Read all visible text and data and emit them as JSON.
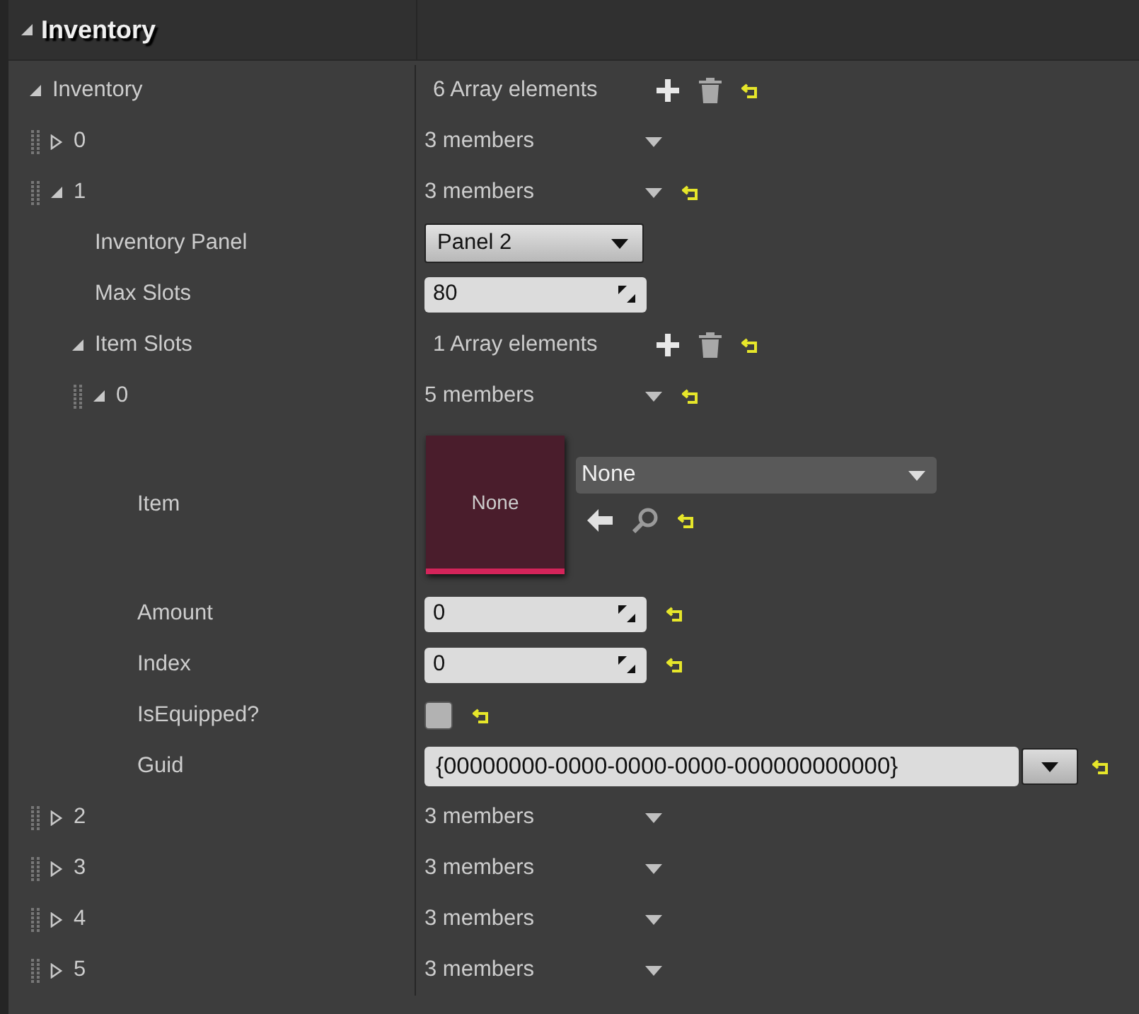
{
  "category": {
    "title": "Inventory",
    "expanded": true
  },
  "tree": [
    {
      "label": "Inventory",
      "kind": "array",
      "value": "6 Array elements",
      "expanded": true,
      "reset": true,
      "children": [
        {
          "label": "0",
          "kind": "element",
          "value": "3 members",
          "expanded": false,
          "reset": false
        },
        {
          "label": "1",
          "kind": "element",
          "value": "3 members",
          "expanded": true,
          "reset": true,
          "children": [
            {
              "label": "Inventory Panel",
              "kind": "combo",
              "value": "Panel 2",
              "reset": false
            },
            {
              "label": "Max Slots",
              "kind": "number",
              "value": "80",
              "reset": false
            },
            {
              "label": "Item Slots",
              "kind": "array",
              "value": "1 Array elements",
              "expanded": true,
              "reset": true,
              "children": [
                {
                  "label": "0",
                  "kind": "element",
                  "value": "5 members",
                  "expanded": true,
                  "reset": true,
                  "children": [
                    {
                      "label": "Item",
                      "kind": "asset",
                      "thumbnail": "None",
                      "value": "None",
                      "reset": true
                    },
                    {
                      "label": "Amount",
                      "kind": "number",
                      "value": "0",
                      "reset": true
                    },
                    {
                      "label": "Index",
                      "kind": "number",
                      "value": "0",
                      "reset": true
                    },
                    {
                      "label": "IsEquipped?",
                      "kind": "checkbox",
                      "checked": false,
                      "reset": true
                    },
                    {
                      "label": "Guid",
                      "kind": "guid",
                      "value": "{00000000-0000-0000-0000-000000000000}",
                      "reset": true
                    }
                  ]
                }
              ]
            }
          ]
        },
        {
          "label": "2",
          "kind": "element",
          "value": "3 members",
          "expanded": false,
          "reset": false
        },
        {
          "label": "3",
          "kind": "element",
          "value": "3 members",
          "expanded": false,
          "reset": false
        },
        {
          "label": "4",
          "kind": "element",
          "value": "3 members",
          "expanded": false,
          "reset": false
        },
        {
          "label": "5",
          "kind": "element",
          "value": "3 members",
          "expanded": false,
          "reset": false
        }
      ]
    }
  ]
}
